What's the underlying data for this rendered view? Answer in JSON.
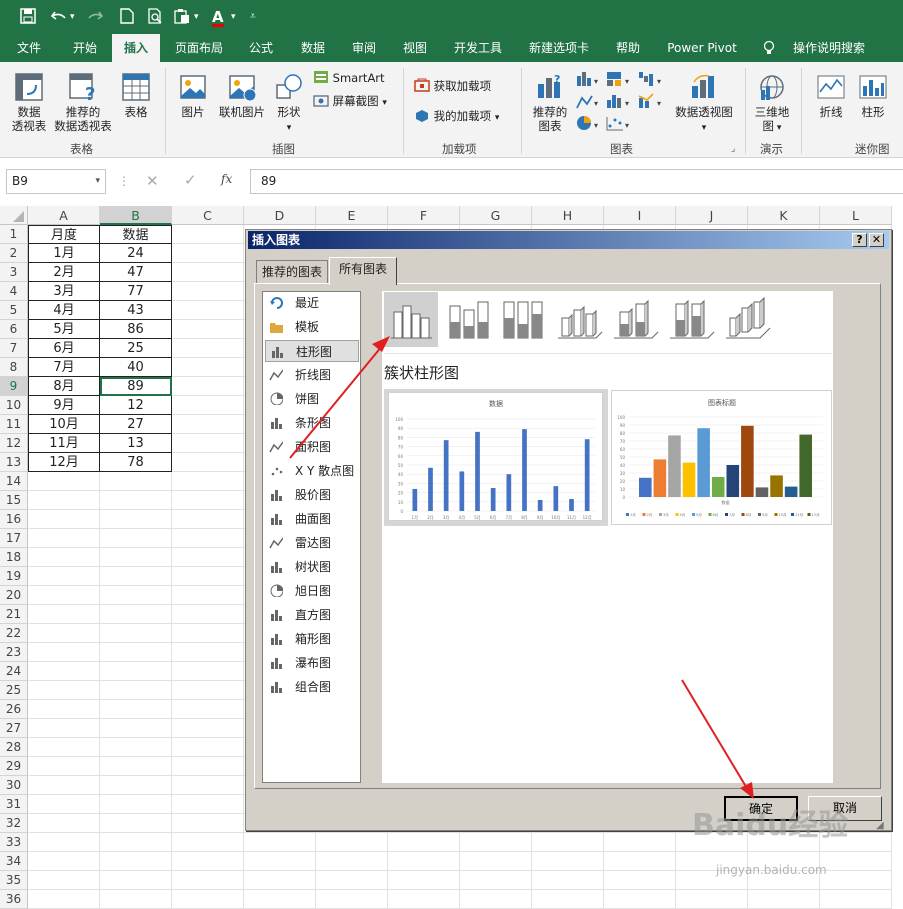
{
  "qat": {
    "save": "save-icon",
    "undo": "undo-icon",
    "redo": "redo-icon",
    "new": "new-icon",
    "preview": "preview-icon",
    "paste": "paste-icon",
    "font_color_letter": "A",
    "more": "more-icon"
  },
  "tabs": [
    "文件",
    "开始",
    "插入",
    "页面布局",
    "公式",
    "数据",
    "审阅",
    "视图",
    "开发工具",
    "新建选项卡",
    "帮助",
    "Power Pivot",
    "操作说明搜索"
  ],
  "active_tab": "插入",
  "ribbon": {
    "table_group": {
      "pivot": "数据\n透视表",
      "recommended_pivot": "推荐的\n数据透视表",
      "table": "表格",
      "label": "表格"
    },
    "illustrations": {
      "picture": "图片",
      "online_picture": "联机图片",
      "shapes": "形状",
      "smartart": "SmartArt",
      "screenshot": "屏幕截图",
      "label": "插图"
    },
    "addins": {
      "get": "获取加载项",
      "my": "我的加载项",
      "label": "加载项"
    },
    "charts": {
      "recommended": "推荐的\n图表",
      "pivot_chart": "数据透视图",
      "label": "图表"
    },
    "tours": {
      "map3d": "三维地\n图",
      "label": "演示"
    },
    "sparklines": {
      "line": "折线",
      "column": "柱形",
      "label": "迷你图"
    }
  },
  "formula": {
    "namebox": "B9",
    "fx": "fx",
    "value": "89"
  },
  "columns": [
    "A",
    "B",
    "C",
    "D",
    "E",
    "F",
    "G",
    "H",
    "I",
    "J",
    "K",
    "L"
  ],
  "rows": [
    "1",
    "2",
    "3",
    "4",
    "5",
    "6",
    "7",
    "8",
    "9",
    "10",
    "11",
    "12",
    "13",
    "14",
    "15",
    "16",
    "17",
    "18",
    "19",
    "20",
    "21",
    "22",
    "23",
    "24",
    "25",
    "26",
    "27",
    "28",
    "29",
    "30",
    "31",
    "32",
    "33",
    "34",
    "35",
    "36"
  ],
  "table": {
    "header": [
      "月度",
      "数据"
    ],
    "months": [
      "1月",
      "2月",
      "3月",
      "4月",
      "5月",
      "6月",
      "7月",
      "8月",
      "9月",
      "10月",
      "11月",
      "12月"
    ],
    "values": [
      "24",
      "47",
      "77",
      "43",
      "86",
      "25",
      "40",
      "89",
      "12",
      "27",
      "13",
      "78"
    ]
  },
  "dialog": {
    "title": "插入图表",
    "help": "?",
    "close": "✕",
    "tab_recommended": "推荐的图表",
    "tab_all": "所有图表",
    "types": [
      "最近",
      "模板",
      "柱形图",
      "折线图",
      "饼图",
      "条形图",
      "面积图",
      "X Y 散点图",
      "股价图",
      "曲面图",
      "雷达图",
      "树状图",
      "旭日图",
      "直方图",
      "箱形图",
      "瀑布图",
      "组合图"
    ],
    "selected_type": "柱形图",
    "subtype_title": "簇状柱形图",
    "ok": "确定",
    "cancel": "取消"
  },
  "chart_data": [
    {
      "type": "bar",
      "title": "数据",
      "categories": [
        "1月",
        "2月",
        "3月",
        "4月",
        "5月",
        "6月",
        "7月",
        "8月",
        "9月",
        "10月",
        "11月",
        "12月"
      ],
      "series": [
        {
          "values": [
            24,
            47,
            77,
            43,
            86,
            25,
            40,
            89,
            12,
            27,
            13,
            78
          ]
        }
      ],
      "ylim": [
        0,
        100
      ],
      "yticks": [
        0,
        10,
        20,
        30,
        40,
        50,
        60,
        70,
        80,
        90,
        100
      ],
      "color": "#4472c4"
    },
    {
      "type": "bar",
      "title": "图表标题",
      "categories": [
        "数据"
      ],
      "series": [
        {
          "name": "1月",
          "values": [
            24
          ]
        },
        {
          "name": "2月",
          "values": [
            47
          ]
        },
        {
          "name": "3月",
          "values": [
            77
          ]
        },
        {
          "name": "4月",
          "values": [
            43
          ]
        },
        {
          "name": "5月",
          "values": [
            86
          ]
        },
        {
          "name": "6月",
          "values": [
            25
          ]
        },
        {
          "name": "7月",
          "values": [
            40
          ]
        },
        {
          "name": "8月",
          "values": [
            89
          ]
        },
        {
          "name": "9月",
          "values": [
            12
          ]
        },
        {
          "name": "10月",
          "values": [
            27
          ]
        },
        {
          "name": "11月",
          "values": [
            13
          ]
        },
        {
          "name": "12月",
          "values": [
            78
          ]
        }
      ],
      "ylim": [
        0,
        100
      ],
      "yticks": [
        0,
        10,
        20,
        30,
        40,
        50,
        60,
        70,
        80,
        90,
        100
      ],
      "legend": "bottom",
      "colors": [
        "#4472c4",
        "#ed7d31",
        "#a5a5a5",
        "#ffc000",
        "#5b9bd5",
        "#70ad47",
        "#264478",
        "#9e480e",
        "#636363",
        "#997300",
        "#255e91",
        "#43682b"
      ]
    }
  ],
  "watermark": {
    "text": "Baidu经验",
    "url": "jingyan.baidu.com"
  }
}
